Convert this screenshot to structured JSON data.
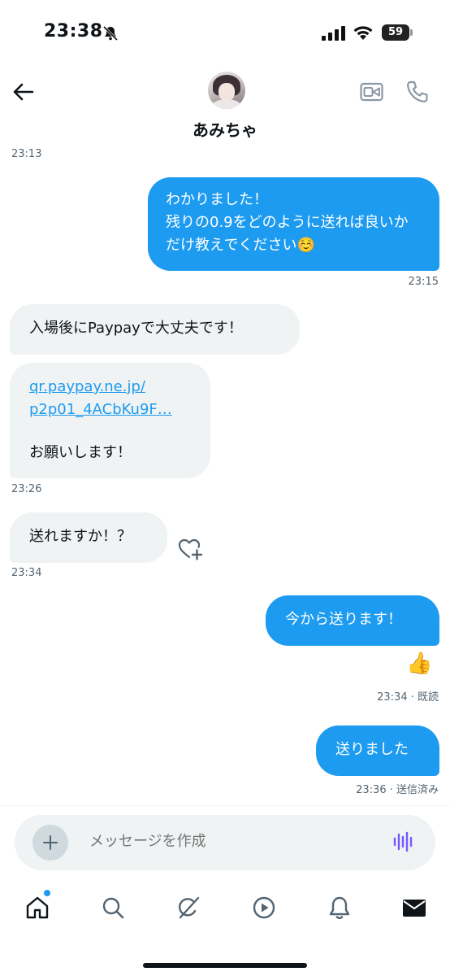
{
  "status_bar": {
    "time": "23:38",
    "battery": "59"
  },
  "header": {
    "contact_name": "あみちゃ"
  },
  "messages": [
    {
      "type": "timestamp",
      "text": "23:13"
    },
    {
      "type": "outgoing",
      "text": "わかりました！\n残りの0.9をどのように送れば良いかだけ教えでください☺️",
      "time": "23:15"
    },
    {
      "type": "incoming",
      "text": "入場後にPaypayで大丈夫です！"
    },
    {
      "type": "incoming",
      "link": "qr.paypay.ne.jp/\np2p01_4ACbKu9F…",
      "text": "お願いします！",
      "time": "23:26"
    },
    {
      "type": "incoming",
      "text": "送れますか！？",
      "time": "23:34"
    },
    {
      "type": "outgoing",
      "text": "今から送ります！",
      "reaction": "👍",
      "time": "23:34 · 既読"
    },
    {
      "type": "outgoing",
      "text": "送りました",
      "time": "23:36 · 送信済み"
    }
  ],
  "composer": {
    "placeholder": "メッセージを作成"
  },
  "icons": {
    "back": "arrow-left-icon",
    "video": "video-camera-icon",
    "phone": "phone-icon",
    "add": "plus-icon",
    "voice": "voice-wave-icon",
    "react": "heart-plus-icon",
    "nav": [
      "home-icon",
      "search-icon",
      "grok-icon",
      "video-play-icon",
      "bell-icon",
      "mail-icon"
    ]
  },
  "colors": {
    "accent": "#1d9bf0",
    "incoming_bubble": "#eff3f4",
    "muted_text": "#536471"
  }
}
